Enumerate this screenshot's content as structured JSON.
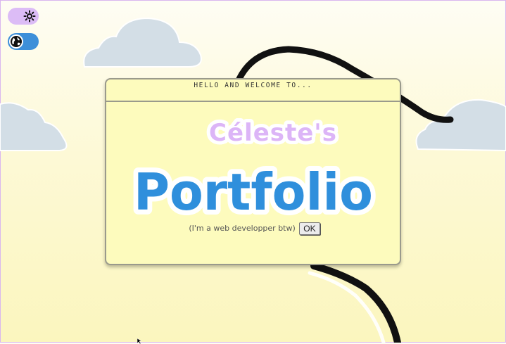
{
  "toggles": {
    "theme": {
      "icon": "sun-icon",
      "state": "light"
    },
    "language": {
      "icon": "globe-icon"
    }
  },
  "window": {
    "title": "HELLO AND WELCOME TO...",
    "name_line": "Céleste's",
    "main_line": "Portfolio",
    "subtitle": "(I'm a web developper btw)",
    "ok_label": "OK"
  },
  "colors": {
    "name_text": "#dcb5f7",
    "main_text": "#2f8fdc",
    "window_bg": "#fdfbbd",
    "cloud": "#d3dee6",
    "road": "#111111"
  }
}
